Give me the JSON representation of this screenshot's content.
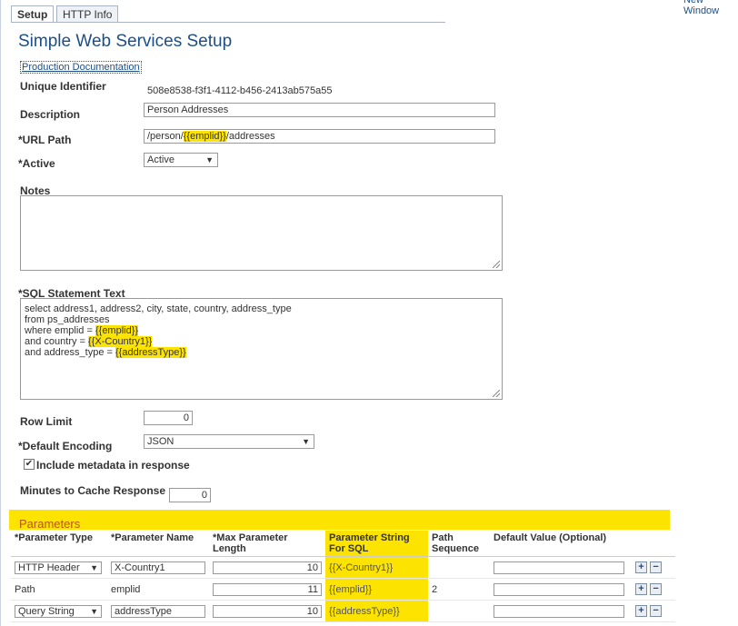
{
  "tabs": [
    {
      "label": "Setup"
    },
    {
      "label": "HTTP Info"
    }
  ],
  "top_right_link": "New Window",
  "page_title": "Simple Web Services Setup",
  "doc_link": "Production Documentation",
  "form": {
    "unique_id_label": "Unique Identifier",
    "unique_id_value": "508e8538-f3f1-4112-b456-2413ab575a55",
    "description_label": "Description",
    "description_value": "Person Addresses",
    "url_path_label": "*URL Path",
    "url_path_pre": "/person/",
    "url_path_param": "{{emplid}}",
    "url_path_post": "/addresses",
    "active_label": "*Active",
    "active_value": "Active",
    "notes_label": "Notes",
    "sql_label": "*SQL Statement Text",
    "sql_line1": "select address1, address2, city, state, country, address_type",
    "sql_line2": "from ps_addresses",
    "sql_line3_pre": "where emplid = ",
    "sql_line3_param": "{{emplid}}",
    "sql_line4_pre": "and country = ",
    "sql_line4_param": "{{X-Country1}}",
    "sql_line5_pre": "and address_type = ",
    "sql_line5_param": "{{addressType}}",
    "row_limit_label": "Row Limit",
    "row_limit_value": "0",
    "encoding_label": "*Default Encoding",
    "encoding_value": "JSON",
    "metadata_label": "Include metadata in response",
    "cache_label": "Minutes to Cache Response",
    "cache_value": "0"
  },
  "parameters": {
    "title": "Parameters",
    "headers": [
      "*Parameter Type",
      "*Parameter Name",
      "*Max Parameter Length",
      "Parameter String For SQL",
      "Path Sequence",
      "Default Value (Optional)"
    ],
    "rows": [
      {
        "type": "HTTP Header",
        "name": "X-Country1",
        "max_len": "10",
        "sql_string": "{{X-Country1}}",
        "path_seq": "",
        "default": ""
      },
      {
        "type": "Path",
        "name": "emplid",
        "max_len": "11",
        "sql_string": "{{emplid}}",
        "path_seq": "2",
        "default": ""
      },
      {
        "type": "Query String",
        "name": "addressType",
        "max_len": "10",
        "sql_string": "{{addressType}}",
        "path_seq": "",
        "default": ""
      }
    ]
  },
  "colors": {
    "highlight": "#fde400",
    "title_blue": "#1c4f86",
    "param_orange": "#b8560b"
  }
}
